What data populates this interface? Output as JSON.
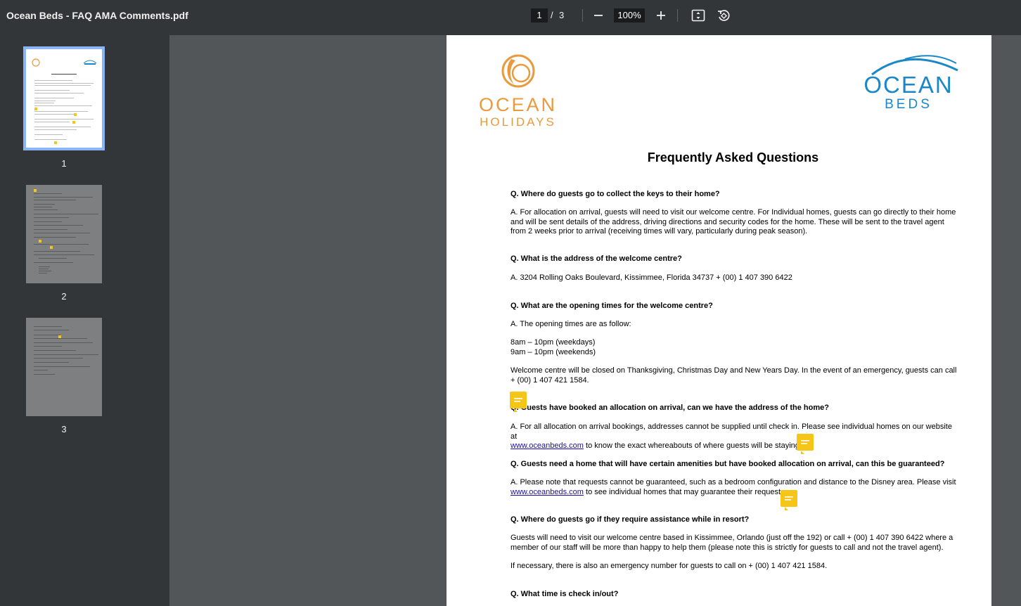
{
  "toolbar": {
    "title": "Ocean Beds - FAQ AMA Comments.pdf",
    "current_page": "1",
    "page_separator": "/",
    "total_pages": "3",
    "zoom": "100%"
  },
  "sidebar": {
    "thumbnails": [
      {
        "label": "1"
      },
      {
        "label": "2"
      },
      {
        "label": "3"
      }
    ]
  },
  "document": {
    "logo_left": {
      "line1": "OCEAN",
      "line2": "HOLIDAYS"
    },
    "logo_right": {
      "line1": "OCEAN",
      "line2": "BEDS"
    },
    "heading": "Frequently Asked Questions",
    "q1": "Q. Where do guests go to collect the keys to their home?",
    "a1": "A. For allocation on arrival, guests will need to visit our welcome centre. For Individual homes, guests can go directly to their home and will be sent details of the address, driving directions and security codes for the home. These will be sent to the travel agent from 2 weeks prior to arrival (receiving times will vary, particularly during peak season).",
    "q2": "Q. What is the address of the welcome centre?",
    "a2": "A. 3204 Rolling Oaks Boulevard, Kissimmee, Florida 34737 + (00) 1 407 390 6422",
    "q3": "Q. What are the opening times for the welcome centre?",
    "a3_intro": "A. The opening times are as follow:",
    "a3_weekdays": "8am – 10pm (weekdays)",
    "a3_weekends": "9am – 10pm (weekends)",
    "a3_closed": "Welcome centre will be closed on Thanksgiving, Christmas Day and New Years Day. In the event of an emergency, guests can call + (00) 1 407 421 1584.",
    "q4": "Q. Guests have booked an allocation on arrival, can we have the address of the home?",
    "a4_before": "A. For all allocation on arrival bookings, addresses cannot be supplied until check in. Please see individual homes on our website at",
    "a4_link": "www.oceanbeds.com",
    "a4_after": " to know the exact whereabouts of where guests will be staying.",
    "q5": "Q. Guests need a home that will have certain amenities but have booked allocation on arrival, can this be guaranteed?",
    "a5_before": "A. Please note that requests cannot be guaranteed, such as a bedroom configuration and distance to the Disney area. Please visit",
    "a5_link": "www.oceanbeds.com",
    "a5_after": " to see individual homes that may guarantee their requests.",
    "q6": "Q. Where do guests go if they require assistance while in resort?",
    "a6": "Guests will need to visit our welcome centre based in Kissimmee, Orlando (just off the 192) or call + (00) 1 407 390 6422 where a member of our staff will be more than happy to help them (please note this is strictly for guests to call and not the travel agent).",
    "a6_emergency": "If necessary, there is also an emergency number for guests to call on + (00) 1 407 421 1584.",
    "q7": "Q. What time is check in/out?"
  },
  "colors": {
    "toolbar_bg": "#323639",
    "viewer_bg": "#525659",
    "comment": "#f5c518",
    "active_thumb": "#8ab4f8",
    "holidays_orange": "#e99a3e",
    "beds_blue": "#1a87c9"
  }
}
